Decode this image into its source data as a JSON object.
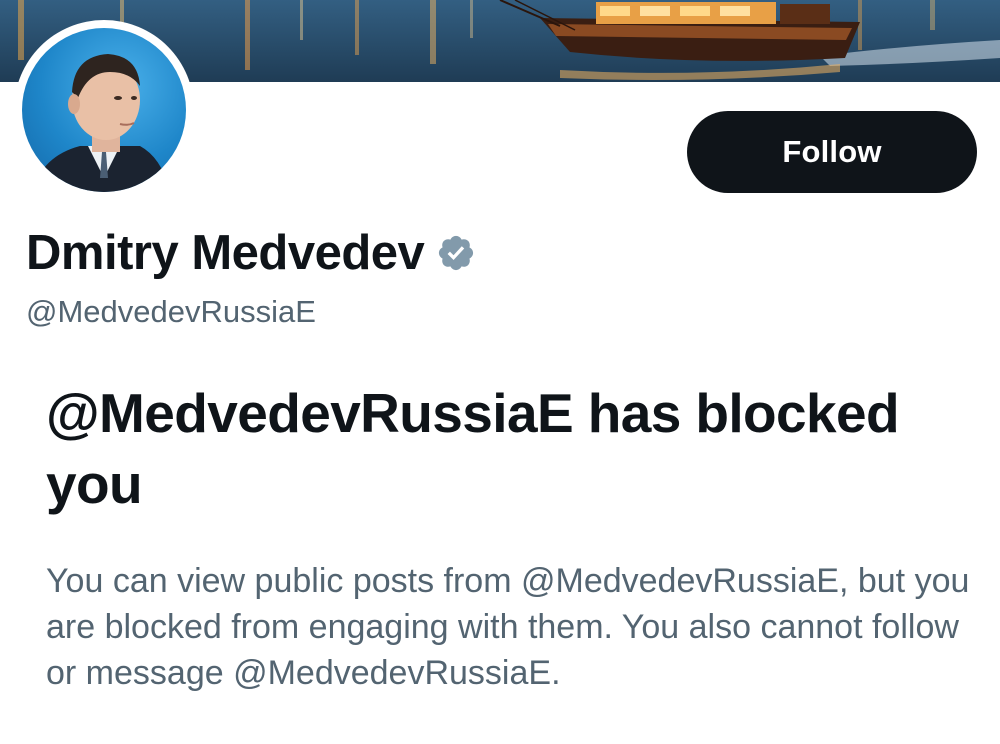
{
  "profile": {
    "display_name": "Dmitry Medvedev",
    "handle": "@MedvedevRussiaE",
    "verified": true,
    "follow_label": "Follow"
  },
  "block_notice": {
    "title": "@MedvedevRussiaE has blocked you",
    "description": "You can view public posts from @MedvedevRussiaE, but you are blocked from engaging with them. You also cannot follow or message @MedvedevRussiaE."
  },
  "icons": {
    "verified": "verified-badge-icon",
    "avatar": "profile-avatar",
    "banner": "header-banner-image"
  },
  "colors": {
    "text_primary": "#0f1419",
    "text_secondary": "#536471",
    "follow_bg": "#0f1419",
    "verified_badge": "#829aab"
  }
}
